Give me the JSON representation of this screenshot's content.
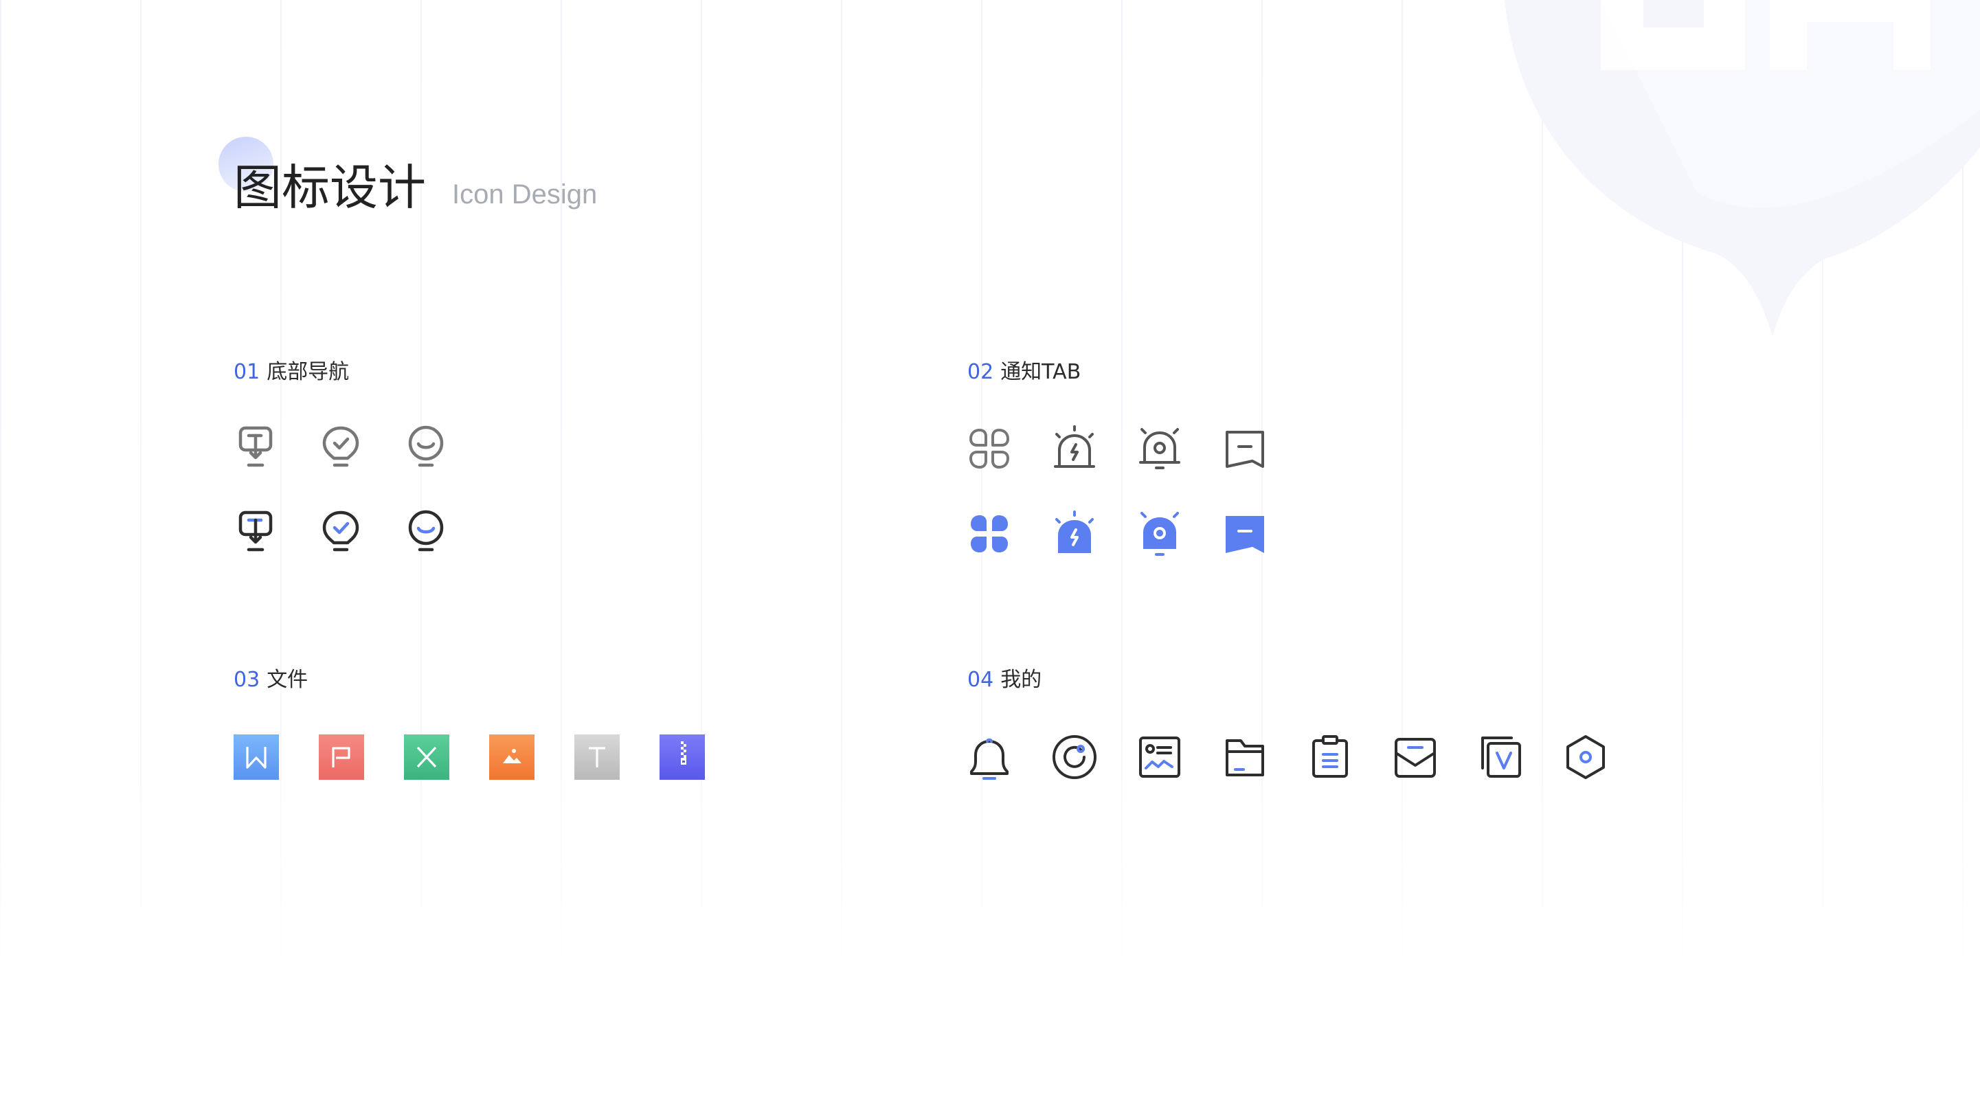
{
  "header": {
    "title_cn": "图标设计",
    "title_en": "Icon Design"
  },
  "sections": [
    {
      "number": "01",
      "label": "底部导航"
    },
    {
      "number": "02",
      "label": "通知TAB"
    },
    {
      "number": "03",
      "label": "文件"
    },
    {
      "number": "04",
      "label": "我的"
    }
  ],
  "icons": {
    "bottom_nav_outline": [
      "board-icon",
      "lightbulb-check-icon",
      "smile-bulb-icon"
    ],
    "bottom_nav_active": [
      "board-icon",
      "lightbulb-check-icon",
      "smile-bulb-icon"
    ],
    "notify_outline": [
      "apps-grid-icon",
      "alarm-lightning-icon",
      "alarm-bell-icon",
      "message-icon"
    ],
    "notify_filled": [
      "apps-grid-icon",
      "alarm-lightning-icon",
      "alarm-bell-icon",
      "message-icon"
    ],
    "files": [
      "word-file-icon",
      "ppt-file-icon",
      "excel-file-icon",
      "image-file-icon",
      "text-file-icon",
      "zip-file-icon"
    ],
    "mine": [
      "bell-icon",
      "record-icon",
      "profile-card-icon",
      "folder-icon",
      "clipboard-icon",
      "inbox-icon",
      "voucher-icon",
      "settings-hexagon-icon"
    ]
  },
  "colors": {
    "accent": "#4165e0",
    "icon_gray": "#777777",
    "icon_dark": "#2d2d2d",
    "icon_blue": "#5b7ff0",
    "word": "#6aa7f7",
    "ppt": "#f07a74",
    "excel": "#48c28e",
    "image": "#f5803f",
    "text": "#c6c6c6",
    "zip": "#6d6cf4"
  }
}
